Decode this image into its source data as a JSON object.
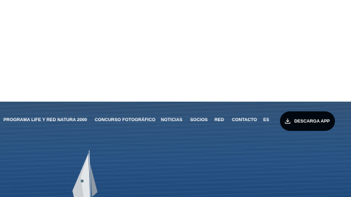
{
  "nav": {
    "items": [
      {
        "label": "PROGRAMA LIFE Y RED NATURA 2000"
      },
      {
        "label": "CONCURSO FOTOGRÁFICO"
      },
      {
        "label": "NOTICIAS"
      },
      {
        "label": "SOCIOS"
      },
      {
        "label": "RED"
      },
      {
        "label": "CONTACTO"
      },
      {
        "label": "ES"
      }
    ],
    "download_button": {
      "label": "DESCARGA APP",
      "icon": "download-icon"
    }
  },
  "hero": {
    "image": "sailboat-on-sea"
  },
  "colors": {
    "sea": "#2a5282",
    "button_bg": "#02080f",
    "nav_text": "#ffffff"
  }
}
